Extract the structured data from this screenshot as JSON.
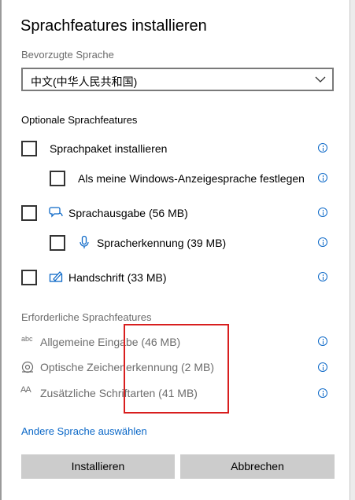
{
  "dialog": {
    "title": "Sprachfeatures installieren"
  },
  "preferred_language": {
    "label": "Bevorzugte Sprache",
    "selected": "中文(中华人民共和国)"
  },
  "optional": {
    "heading": "Optionale Sprachfeatures",
    "items": [
      {
        "label": "Sprachpaket installieren",
        "checked": false,
        "icon": null
      },
      {
        "label": "Als meine Windows-Anzeigesprache festlegen",
        "checked": false,
        "icon": null
      },
      {
        "label": "Sprachausgabe (56 MB)",
        "checked": false,
        "icon": "speech-bubble-icon"
      },
      {
        "label": "Spracherkennung (39 MB)",
        "checked": false,
        "icon": "microphone-icon"
      },
      {
        "label": "Handschrift (33 MB)",
        "checked": false,
        "icon": "pen-icon"
      }
    ]
  },
  "required": {
    "heading": "Erforderliche Sprachfeatures",
    "items": [
      {
        "label": "Allgemeine Eingabe (46 MB)",
        "icon": "abc-icon",
        "icon_text": "abc"
      },
      {
        "label": "Optische Zeichenerkennung (2 MB)",
        "icon": "ocr-eye-icon"
      },
      {
        "label": "Zusätzliche Schriftarten (41 MB)",
        "icon": "font-aa-icon",
        "icon_text": "AA"
      }
    ]
  },
  "links": {
    "choose_other_language": "Andere Sprache auswählen"
  },
  "buttons": {
    "install": "Installieren",
    "cancel": "Abbrechen"
  },
  "colors": {
    "accent": "#0a67c7",
    "annotation_box": "#d81e1e",
    "button_bg": "#cccccc"
  }
}
